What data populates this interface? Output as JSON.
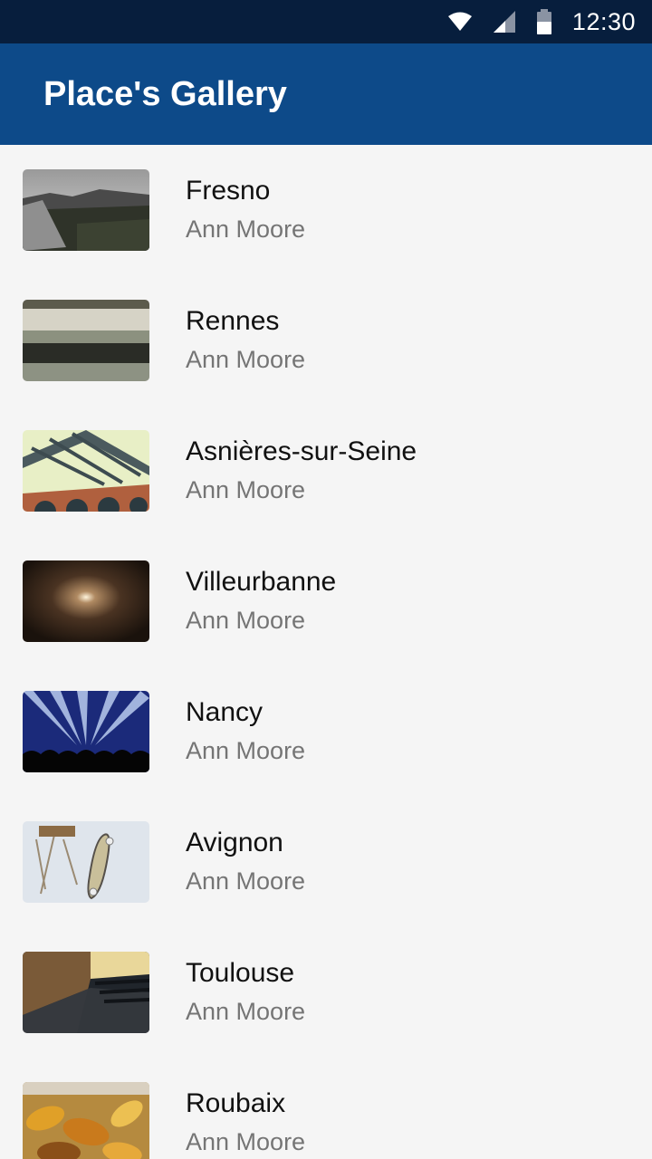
{
  "status_bar": {
    "time": "12:30",
    "icons": [
      "wifi-icon",
      "cell-signal-icon",
      "battery-icon"
    ]
  },
  "app_bar": {
    "title": "Place's Gallery",
    "color": "#0d4a89"
  },
  "places": [
    {
      "name": "Fresno",
      "author": "Ann Moore",
      "thumbnail": "misty-mountain-thumbnail"
    },
    {
      "name": "Rennes",
      "author": "Ann Moore",
      "thumbnail": "frosty-field-thumbnail"
    },
    {
      "name": "Asnières-sur-Seine",
      "author": "Ann Moore",
      "thumbnail": "bridge-thumbnail"
    },
    {
      "name": "Villeurbanne",
      "author": "Ann Moore",
      "thumbnail": "tunnel-light-thumbnail"
    },
    {
      "name": "Nancy",
      "author": "Ann Moore",
      "thumbnail": "concert-lights-thumbnail"
    },
    {
      "name": "Avignon",
      "author": "Ann Moore",
      "thumbnail": "skateboard-thumbnail"
    },
    {
      "name": "Toulouse",
      "author": "Ann Moore",
      "thumbnail": "theater-seats-thumbnail"
    },
    {
      "name": "Roubaix",
      "author": "Ann Moore",
      "thumbnail": "autumn-leaves-thumbnail"
    }
  ]
}
